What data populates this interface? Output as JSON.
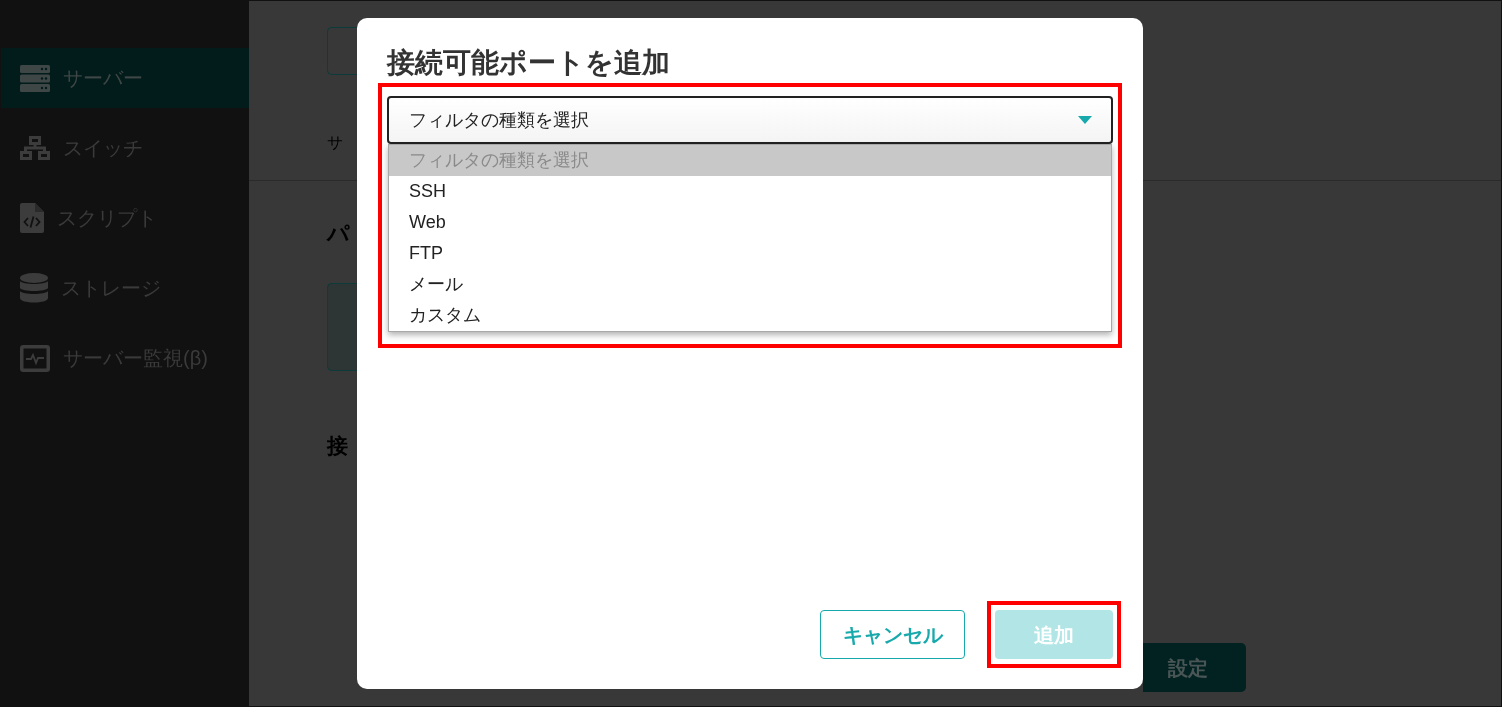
{
  "sidebar": {
    "items": [
      {
        "label": "サーバー",
        "selected": true
      },
      {
        "label": "スイッチ",
        "selected": false
      },
      {
        "label": "スクリプト",
        "selected": false
      },
      {
        "label": "ストレージ",
        "selected": false
      },
      {
        "label": "サーバー監視(β)",
        "selected": false
      }
    ]
  },
  "page": {
    "breadcrumb": "サ",
    "heading": "パ",
    "section_heading": "接",
    "settings_button": "設定"
  },
  "dialog": {
    "title": "接続可能ポートを追加",
    "filter_select": {
      "value": "フィルタの種類を選択",
      "expanded": true,
      "highlighted": true,
      "options": [
        {
          "label": "フィルタの種類を選択",
          "selected": true,
          "disabled": true
        },
        {
          "label": "SSH",
          "selected": false,
          "disabled": false
        },
        {
          "label": "Web",
          "selected": false,
          "disabled": false
        },
        {
          "label": "FTP",
          "selected": false,
          "disabled": false
        },
        {
          "label": "メール",
          "selected": false,
          "disabled": false
        },
        {
          "label": "カスタム",
          "selected": false,
          "disabled": false
        }
      ]
    },
    "buttons": [
      {
        "label": "キャンセル",
        "kind": "outline",
        "disabled": false,
        "highlighted": false
      },
      {
        "label": "追加",
        "kind": "primary",
        "disabled": true,
        "highlighted": true
      }
    ]
  }
}
